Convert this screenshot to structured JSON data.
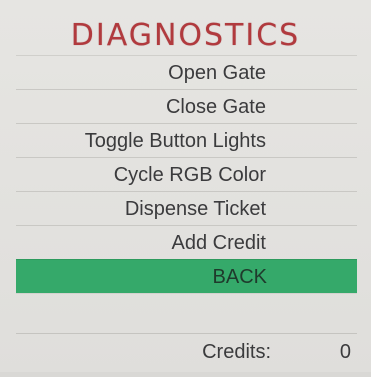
{
  "title": "DIAGNOSTICS",
  "menu": {
    "items": [
      {
        "label": "Open Gate"
      },
      {
        "label": "Close Gate"
      },
      {
        "label": "Toggle Button Lights"
      },
      {
        "label": "Cycle RGB Color"
      },
      {
        "label": "Dispense Ticket"
      },
      {
        "label": "Add Credit"
      }
    ],
    "back_label": "BACK"
  },
  "credits": {
    "label": "Credits:",
    "value": "0"
  },
  "colors": {
    "title": "#b13a3e",
    "selected_row": "#35a96a",
    "background": "#e4e3e0",
    "text": "#3b3b3d"
  }
}
